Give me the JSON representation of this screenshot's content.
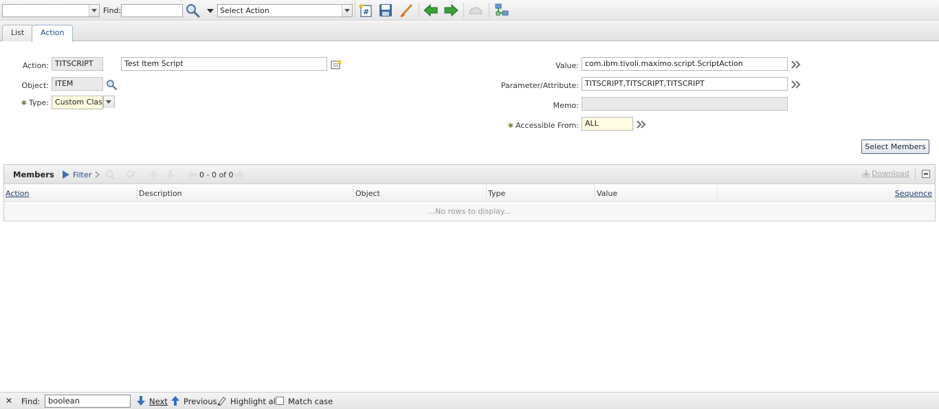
{
  "toolbar": {
    "record_combo_value": "",
    "find_label": "Find:",
    "find_value": "",
    "select_action": "Select Action"
  },
  "tabs": [
    {
      "label": "List",
      "active": false
    },
    {
      "label": "Action",
      "active": true
    }
  ],
  "form": {
    "action_label": "Action:",
    "action_value": "TITSCRIPT",
    "action_description": "Test Item Script",
    "object_label": "Object:",
    "object_value": "ITEM",
    "type_label": "Type:",
    "type_value": "Custom Class",
    "value_label": "Value:",
    "value_value": "com.ibm.tivoli.maximo.script.ScriptAction",
    "param_label": "Parameter/Attribute:",
    "param_value": "TITSCRIPT,TITSCRIPT,TITSCRIPT",
    "memo_label": "Memo:",
    "memo_value": "",
    "accessible_label": "Accessible From:",
    "accessible_value": "ALL",
    "select_members_label": "Select Members"
  },
  "members": {
    "title": "Members",
    "filter_label": "Filter",
    "count": "0 - 0 of 0",
    "download_label": "Download",
    "columns": [
      "Action",
      "Description",
      "Object",
      "Type",
      "Value",
      "Sequence"
    ],
    "empty_text": "...No rows to display..."
  },
  "findbar": {
    "close": "✕",
    "find_label": "Find:",
    "find_value": "boolean",
    "next_label": "Next",
    "previous_label": "Previous",
    "highlight_label": "Highlight all",
    "match_case_label": "Match case"
  },
  "colors": {
    "accent_blue": "#1f4e8c",
    "arrow_green": "#3aa33a",
    "required_marker": "#6a8b3c"
  }
}
